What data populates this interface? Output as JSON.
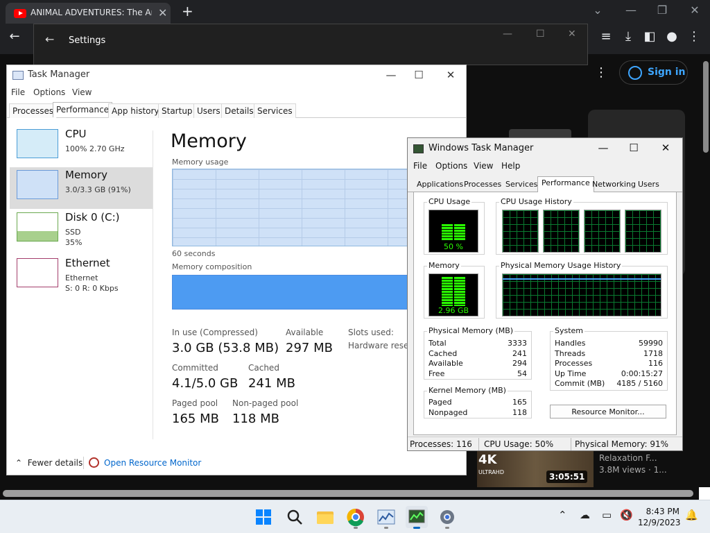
{
  "browser": {
    "tab_title": "ANIMAL ADVENTURES: The Amazing",
    "close_glyph": "✕",
    "new_tab_glyph": "+",
    "settings_title": "Settings",
    "sign_in": "Sign in",
    "video": {
      "badge_4k": "4K",
      "badge_uhd": "ULTRAHD",
      "duration": "3:05:51",
      "title": "Relaxation F...",
      "views": "3.8M views · 1..."
    }
  },
  "task_manager": {
    "title": "Task Manager",
    "menu": [
      "File",
      "Options",
      "View"
    ],
    "tabs": [
      "Processes",
      "Performance",
      "App history",
      "Startup",
      "Users",
      "Details",
      "Services"
    ],
    "selected_tab": "Performance",
    "side": [
      {
        "name": "CPU",
        "sub1": "100% 2.70 GHz",
        "sub2": ""
      },
      {
        "name": "Memory",
        "sub1": "3.0/3.3 GB (91%)",
        "sub2": ""
      },
      {
        "name": "Disk 0 (C:)",
        "sub1": "SSD",
        "sub2": "35%"
      },
      {
        "name": "Ethernet",
        "sub1": "Ethernet",
        "sub2": "S: 0 R: 0 Kbps"
      }
    ],
    "memory": {
      "title": "Memory",
      "usage_label": "Memory usage",
      "seconds_label": "60 seconds",
      "composition_label": "Memory composition",
      "in_use_label": "In use (Compressed)",
      "in_use_value": "3.0 GB (53.8 MB)",
      "available_label": "Available",
      "available_value": "297 MB",
      "slots_label": "Slots used:",
      "hw_reserved_label": "Hardware reserved:",
      "committed_label": "Committed",
      "committed_value": "4.1/5.0 GB",
      "cached_label": "Cached",
      "cached_value": "241 MB",
      "paged_label": "Paged pool",
      "paged_value": "165 MB",
      "nonpaged_label": "Non-paged pool",
      "nonpaged_value": "118 MB"
    },
    "fewer_details": "Fewer details",
    "open_resource_monitor": "Open Resource Monitor"
  },
  "windows_task_manager": {
    "title": "Windows Task Manager",
    "menu": [
      "File",
      "Options",
      "View",
      "Help"
    ],
    "tabs": [
      "Applications",
      "Processes",
      "Services",
      "Performance",
      "Networking",
      "Users"
    ],
    "selected_tab": "Performance",
    "cpu_usage_label": "CPU Usage",
    "cpu_usage_value": "50 %",
    "cpu_history_label": "CPU Usage History",
    "memory_label": "Memory",
    "memory_value": "2.96 GB",
    "phys_history_label": "Physical Memory Usage History",
    "physical_memory": {
      "label": "Physical Memory (MB)",
      "rows": [
        [
          "Total",
          "3333"
        ],
        [
          "Cached",
          "241"
        ],
        [
          "Available",
          "294"
        ],
        [
          "Free",
          "54"
        ]
      ]
    },
    "kernel_memory": {
      "label": "Kernel Memory (MB)",
      "rows": [
        [
          "Paged",
          "165"
        ],
        [
          "Nonpaged",
          "118"
        ]
      ]
    },
    "system": {
      "label": "System",
      "rows": [
        [
          "Handles",
          "59990"
        ],
        [
          "Threads",
          "1718"
        ],
        [
          "Processes",
          "116"
        ],
        [
          "Up Time",
          "0:00:15:27"
        ],
        [
          "Commit (MB)",
          "4185 / 5160"
        ]
      ]
    },
    "resource_monitor_button": "Resource Monitor...",
    "status": {
      "processes": "Processes: 116",
      "cpu": "CPU Usage: 50%",
      "memory": "Physical Memory: 91%"
    }
  },
  "taskbar": {
    "time": "8:43 PM",
    "date": "12/9/2023"
  },
  "colors": {
    "accent": "#0067c0",
    "graph_green": "#29ff00",
    "memory_fill": "#4d9bf2",
    "youtube_blue": "#3ea6ff"
  }
}
